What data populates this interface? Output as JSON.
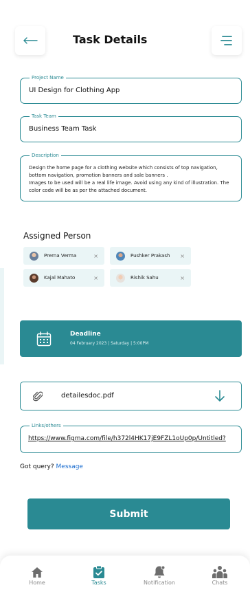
{
  "header": {
    "title": "Task Details",
    "back_icon": "arrow-left-icon",
    "menu_icon": "menu-lines-icon"
  },
  "project": {
    "legend": "Project Name",
    "value": "UI Design for Clothing App"
  },
  "team": {
    "legend": "Task Team",
    "value": "Business Team Task"
  },
  "description": {
    "legend": "Description",
    "para1": "Design the  home page for a clothing website which consists of  top navigation, bottom navigation, promotion banners and sale banners .",
    "para2": "Images to be used will be a real life image. Avoid using any kind of illustration. The color code will be as per the attached document."
  },
  "assigned": {
    "title": "Assigned Person",
    "people": [
      {
        "name": "Prerna Verma",
        "remove": "×"
      },
      {
        "name": "Pushker Prakash",
        "remove": "×"
      },
      {
        "name": "Kajal Mahato",
        "remove": "×"
      },
      {
        "name": "Rishik Sahu",
        "remove": "×"
      }
    ]
  },
  "deadline": {
    "title": "Deadline",
    "date": "04 February 2023 | Saturday | 5:00PM",
    "icon": "calendar-icon"
  },
  "attachment": {
    "file_name": "detailesdoc.pdf",
    "clip_icon": "paperclip-icon",
    "download_icon": "download-arrow-icon"
  },
  "links": {
    "legend": "Links/others",
    "value": "https://www.figma.com/file/h372l4HK17jE9FZL1oUp0p/Untitled?"
  },
  "query": {
    "text": "Got query?",
    "link": "Message"
  },
  "submit_label": "Submit",
  "nav": [
    {
      "label": "Home",
      "icon": "home-icon",
      "active": false
    },
    {
      "label": "Tasks",
      "icon": "clipboard-check-icon",
      "active": true
    },
    {
      "label": "Notification",
      "icon": "bell-icon",
      "active": false
    },
    {
      "label": "Chats",
      "icon": "people-icon",
      "active": false
    }
  ],
  "colors": {
    "accent": "#2a8a93",
    "chip_bg": "#eaf5f6",
    "link": "#1e6fd0"
  }
}
